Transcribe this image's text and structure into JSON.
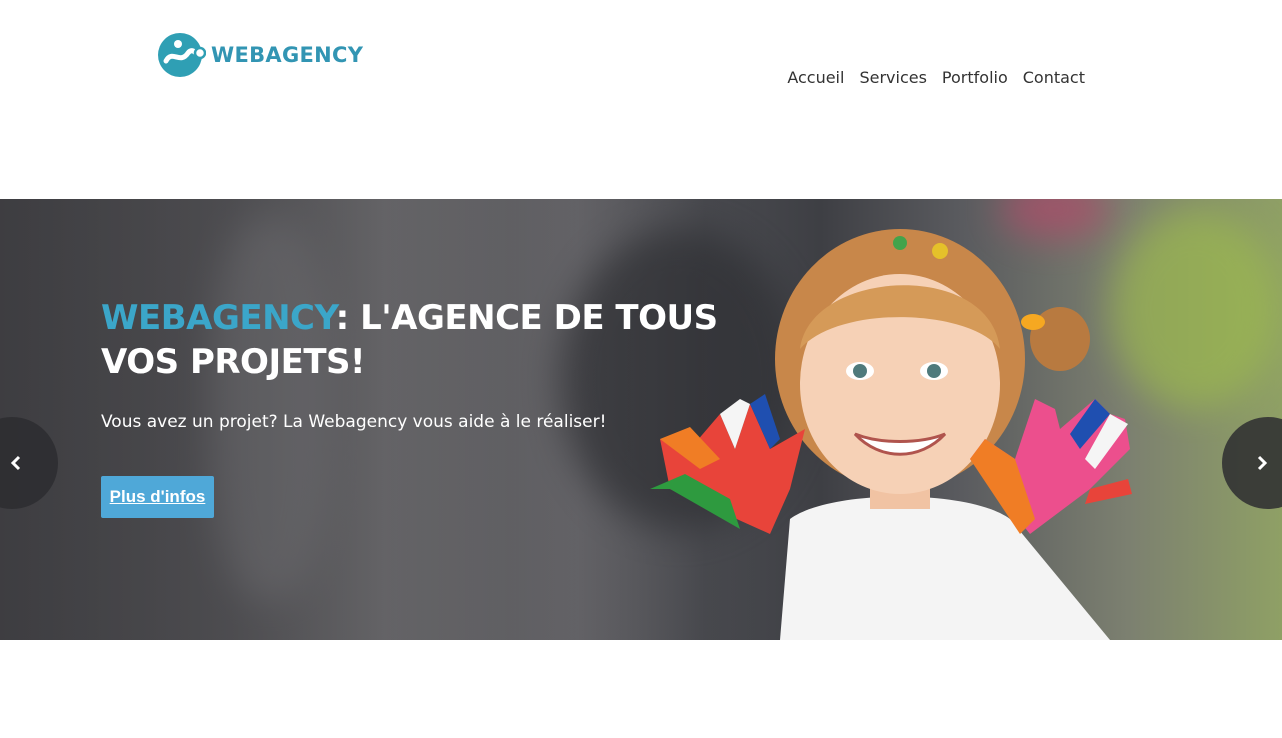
{
  "brand": {
    "name": "WEBAGENCY",
    "color": "#3295b3"
  },
  "nav": {
    "items": [
      {
        "label": "Accueil"
      },
      {
        "label": "Services"
      },
      {
        "label": "Portfolio"
      },
      {
        "label": "Contact"
      }
    ]
  },
  "hero": {
    "title_accent": "WEBAGENCY",
    "title_rest": ": L'AGENCE DE TOUS VOS PROJETS!",
    "subtitle": "Vous avez un projet? La Webagency vous aide à le réaliser!",
    "button_label": "Plus d'infos",
    "accent_color": "#3ba6c9",
    "button_color": "#4fa8d8",
    "prev_icon": "chevron-left-icon",
    "next_icon": "chevron-right-icon"
  }
}
